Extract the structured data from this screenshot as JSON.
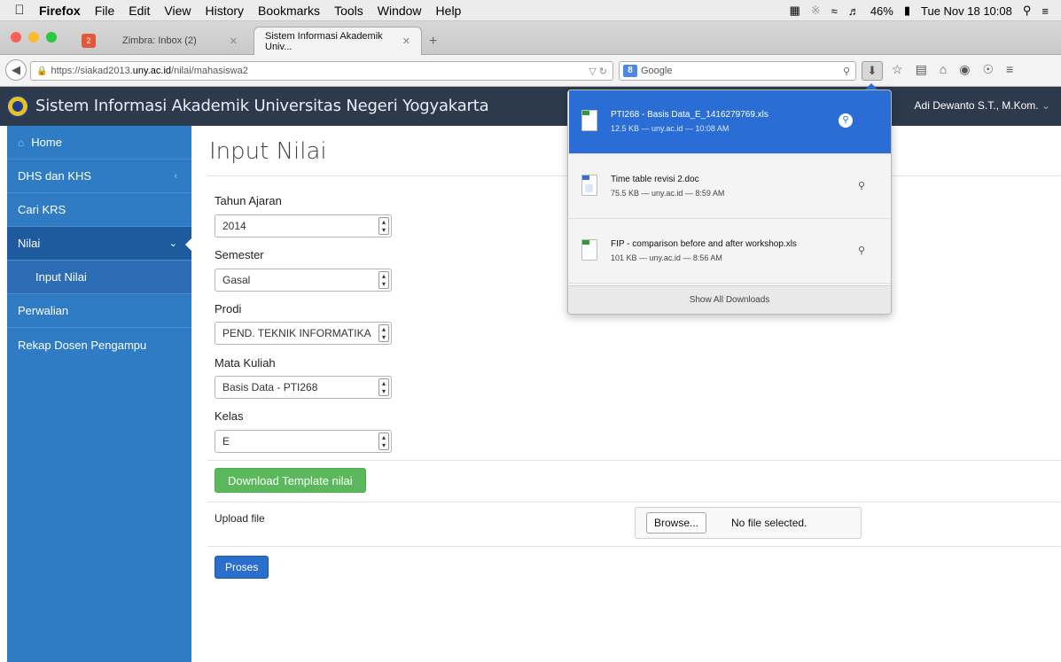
{
  "menubar": {
    "app": "Firefox",
    "items": [
      "File",
      "Edit",
      "View",
      "History",
      "Bookmarks",
      "Tools",
      "Window",
      "Help"
    ],
    "battery": "46%",
    "datetime": "Tue Nov 18  10:08"
  },
  "tabs": [
    {
      "title": "Zimbra: Inbox (2)",
      "active": false
    },
    {
      "title": "Sistem Informasi Akademik Univ...",
      "active": true
    }
  ],
  "navbar": {
    "url_prefix": "https://siakad2013.",
    "url_host": "uny.ac.id",
    "url_path": "/nilai/mahasiswa2",
    "search_placeholder": "Google"
  },
  "site": {
    "title": "Sistem Informasi Akademik Universitas Negeri Yogyakarta",
    "user": "Adi Dewanto S.T., M.Kom."
  },
  "sidebar": {
    "items": [
      {
        "label": "Home"
      },
      {
        "label": "DHS dan KHS"
      },
      {
        "label": "Cari KRS"
      },
      {
        "label": "Nilai"
      },
      {
        "label": "Input Nilai"
      },
      {
        "label": "Perwalian"
      },
      {
        "label": "Rekap Dosen Pengampu"
      }
    ]
  },
  "main": {
    "title": "Input Nilai",
    "fields": [
      {
        "label": "Tahun Ajaran",
        "value": "2014"
      },
      {
        "label": "Semester",
        "value": "Gasal"
      },
      {
        "label": "Prodi",
        "value": "PEND. TEKNIK INFORMATIKA"
      },
      {
        "label": "Mata Kuliah",
        "value": "Basis Data - PTI268"
      },
      {
        "label": "Kelas",
        "value": "E"
      }
    ],
    "download_button": "Download Template nilai",
    "upload_label": "Upload file",
    "browse_button": "Browse...",
    "no_file": "No file selected.",
    "submit_button": "Proses"
  },
  "downloads": {
    "items": [
      {
        "name": "PTI268 - Basis Data_E_1416279769.xls",
        "meta": "12.5 KB — uny.ac.id — 10:08 AM",
        "type": "xls"
      },
      {
        "name": "Time table revisi 2.doc",
        "meta": "75.5 KB — uny.ac.id — 8:59 AM",
        "type": "doc"
      },
      {
        "name": "FIP - comparison before and after workshop.xls",
        "meta": "101 KB — uny.ac.id — 8:56 AM",
        "type": "xls"
      }
    ],
    "show_all": "Show All Downloads"
  },
  "colors": {
    "header_bg": "#2d3a4b",
    "sidebar_bg": "#2f7bc4",
    "download_selected": "#2a6dd4",
    "green_button": "#5cb85c",
    "blue_button": "#2a6fcc"
  }
}
